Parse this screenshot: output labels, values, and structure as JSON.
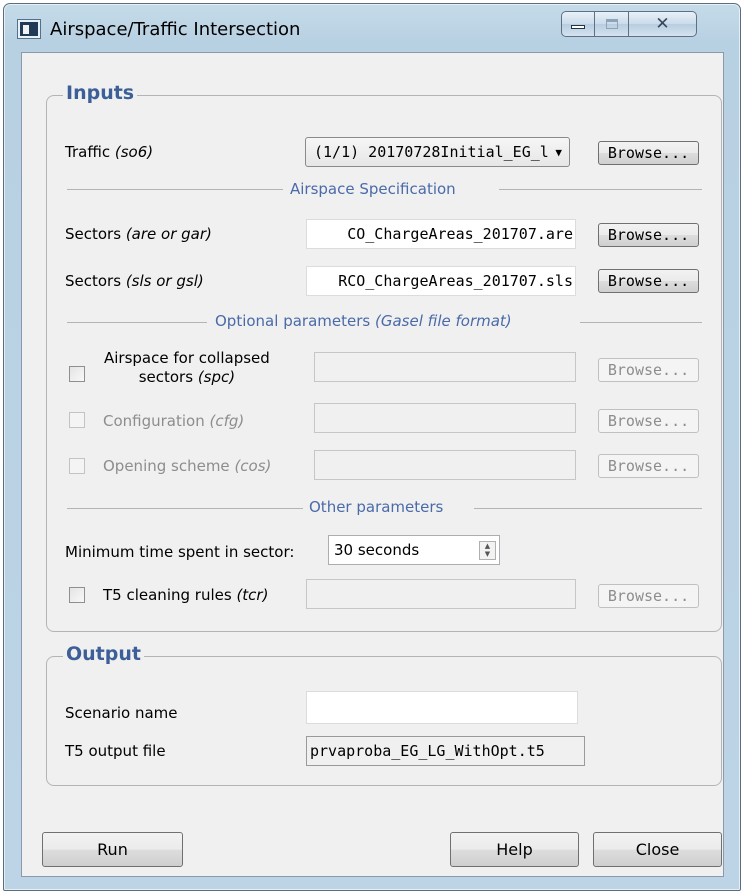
{
  "window": {
    "title": "Airspace/Traffic Intersection",
    "controls": {
      "minimize": "minimize-icon",
      "maximize": "maximize-icon",
      "close": "close-icon"
    }
  },
  "inputs": {
    "title": "Inputs",
    "traffic": {
      "label": "Traffic",
      "hint": "(so6)",
      "combo_value": "(1/1) 20170728Initial_EG_l",
      "browse": "Browse..."
    },
    "airspace_spec": {
      "heading": "Airspace Specification",
      "sectors_are": {
        "label": "Sectors",
        "hint": "(are or gar)",
        "value": "CO_ChargeAreas_201707.are",
        "browse": "Browse..."
      },
      "sectors_sls": {
        "label": "Sectors",
        "hint": "(sls or gsl)",
        "value": "RCO_ChargeAreas_201707.sls",
        "browse": "Browse..."
      }
    },
    "optional": {
      "heading": "Optional parameters",
      "heading_hint": "(Gasel file format)",
      "collapsed": {
        "label_line1": "Airspace for collapsed",
        "label_line2": "sectors",
        "hint": "(spc)",
        "value": "",
        "browse": "Browse..."
      },
      "configuration": {
        "label": "Configuration",
        "hint": "(cfg)",
        "value": "",
        "browse": "Browse..."
      },
      "opening": {
        "label": "Opening scheme",
        "hint": "(cos)",
        "value": "",
        "browse": "Browse..."
      }
    },
    "other": {
      "heading": "Other parameters",
      "min_time_label": "Minimum time spent in sector:",
      "min_time_value": "30 seconds",
      "t5_cleaning": {
        "label": "T5 cleaning rules",
        "hint": "(tcr)",
        "value": "",
        "browse": "Browse..."
      }
    }
  },
  "output": {
    "title": "Output",
    "scenario_label": "Scenario name",
    "scenario_value": "",
    "t5_label": "T5 output file",
    "t5_value": "prvaproba_EG_LG_WithOpt.t5"
  },
  "buttons": {
    "run": "Run",
    "help": "Help",
    "close": "Close"
  }
}
